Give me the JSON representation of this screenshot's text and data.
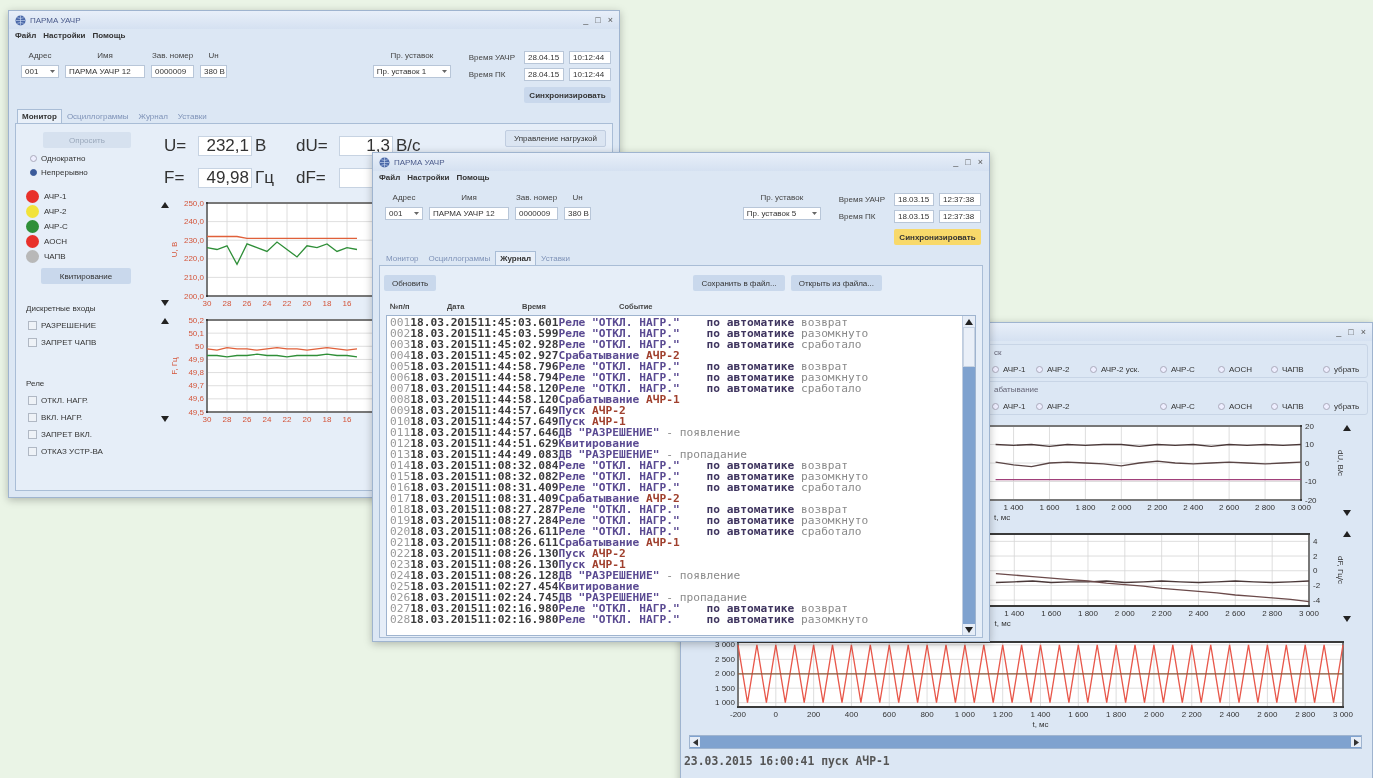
{
  "monitor_window": {
    "title": "ПАРМА УАЧР",
    "controls": [
      "_",
      "□",
      "×"
    ],
    "menu": [
      "Файл",
      "Настройки",
      "Помощь"
    ],
    "device": {
      "labels": [
        "Адрес",
        "Имя",
        "Зав. номер",
        "Uн"
      ],
      "address": "001",
      "name": "ПАРМА УАЧР 12",
      "serial": "0000009",
      "voltage": "380 В"
    },
    "settings": {
      "label": "Пр. уставок",
      "value": "Пр. уставок 1"
    },
    "clock": {
      "device_label": "Время УАЧР",
      "device_date": "28.04.15",
      "device_time": "10:12:44",
      "pc_label": "Время ПК",
      "pc_date": "28.04.15",
      "pc_time": "10:12:44"
    },
    "sync_button": {
      "label": "Синхронизировать",
      "highlighted": false
    },
    "tabs": [
      {
        "label": "Монитор",
        "selected": true
      },
      {
        "label": "Осциллограммы",
        "selected": false
      },
      {
        "label": "Журнал",
        "selected": false
      },
      {
        "label": "Уставки",
        "selected": false
      }
    ],
    "poll_button": {
      "label": "Опросить",
      "disabled": true
    },
    "poll_modes": [
      {
        "label": "Однократно",
        "selected": false
      },
      {
        "label": "Непрерывно",
        "selected": true
      }
    ],
    "indicators": [
      {
        "label": "АЧР-1",
        "color": "#e8302a"
      },
      {
        "label": "АЧР-2",
        "color": "#f2e33a"
      },
      {
        "label": "АЧР-С",
        "color": "#2f8f38"
      },
      {
        "label": "АОСН",
        "color": "#e8302a"
      },
      {
        "label": "ЧАПВ",
        "color": "#b8b8b8"
      }
    ],
    "ack_button": "Квитирование",
    "inputs": {
      "title": "Дискретные входы",
      "items": [
        {
          "label": "РАЗРЕШЕНИЕ",
          "checked": false
        },
        {
          "label": "ЗАПРЕТ ЧАПВ",
          "checked": false
        }
      ]
    },
    "relays": {
      "title": "Реле",
      "items": [
        {
          "label": "ОТКЛ. НАГР.",
          "checked": false
        },
        {
          "label": "ВКЛ. НАГР.",
          "checked": false
        },
        {
          "label": "ЗАПРЕТ ВКЛ.",
          "checked": false
        },
        {
          "label": "ОТКАЗ УСТР-ВА",
          "checked": false
        }
      ]
    },
    "readings": [
      {
        "label": "U=",
        "value": "232,1",
        "unit": "В"
      },
      {
        "label": "dU=",
        "value": "1,3",
        "unit": "В/с"
      },
      {
        "label": "F=",
        "value": "49,98",
        "unit": "Гц"
      },
      {
        "label": "dF="
      }
    ],
    "load_control": "Управление нагрузкой",
    "voltage_chart": {
      "chart_data": {
        "type": "line",
        "ylabel": "U, В",
        "grid": true,
        "x": [
          30,
          29,
          28,
          27,
          26,
          25,
          24,
          23,
          22,
          21,
          20,
          19,
          18,
          17,
          16,
          15
        ],
        "xlim": [
          30,
          13
        ],
        "ylim": [
          200,
          250
        ],
        "xticks": [
          30,
          28,
          26,
          24,
          22,
          20,
          18,
          16
        ],
        "yticks": [
          {
            "value": 200,
            "label": "200,0"
          },
          {
            "value": 210,
            "label": "210,0"
          },
          {
            "value": 220,
            "label": "220,0"
          },
          {
            "value": 230,
            "label": "230,0"
          },
          {
            "value": 240,
            "label": "240,0"
          },
          {
            "value": 250,
            "label": "250,0"
          }
        ],
        "series": [
          {
            "color": "#e0603a",
            "values": [
              232,
              232,
              232,
              232,
              231,
              231,
              231,
              231,
              231,
              231,
              231,
              231,
              231,
              231,
              231,
              231
            ]
          },
          {
            "color": "#2f8f38",
            "values": [
              226,
              225,
              227,
              217,
              228,
              226,
              224,
              229,
              225,
              221,
              227,
              226,
              228,
              224,
              226,
              225
            ]
          }
        ]
      }
    },
    "frequency_chart": {
      "chart_data": {
        "type": "line",
        "ylabel": "F, Гц",
        "grid": true,
        "x": [
          30,
          29,
          28,
          27,
          26,
          25,
          24,
          23,
          22,
          21,
          20,
          19,
          18,
          17,
          16,
          15
        ],
        "xlim": [
          30,
          13
        ],
        "ylim": [
          49.5,
          50.2
        ],
        "xticks": [
          30,
          28,
          26,
          24,
          22,
          20,
          18,
          16
        ],
        "yticks": [
          {
            "value": 49.5,
            "label": "49,5"
          },
          {
            "value": 49.6,
            "label": "49,6"
          },
          {
            "value": 49.7,
            "label": "49,7"
          },
          {
            "value": 49.8,
            "label": "49,8"
          },
          {
            "value": 49.9,
            "label": "49,9"
          },
          {
            "value": 50,
            "label": "50"
          },
          {
            "value": 50.1,
            "label": "50,1"
          },
          {
            "value": 50.2,
            "label": "50,2"
          }
        ],
        "series": [
          {
            "color": "#e0603a",
            "values": [
              49.98,
              49.97,
              49.99,
              49.98,
              49.98,
              49.97,
              49.98,
              49.99,
              49.98,
              49.98,
              49.97,
              49.98,
              49.99,
              49.98,
              49.97,
              49.98
            ]
          },
          {
            "color": "#2f8f38",
            "values": [
              49.93,
              49.93,
              49.92,
              49.93,
              49.93,
              49.94,
              49.93,
              49.93,
              49.92,
              49.93,
              49.93,
              49.93,
              49.94,
              49.93,
              49.93,
              49.92
            ]
          }
        ]
      }
    }
  },
  "journal_window": {
    "title": "ПАРМА УАЧР",
    "controls": [
      "_",
      "□",
      "×"
    ],
    "menu": [
      "Файл",
      "Настройки",
      "Помощь"
    ],
    "device": {
      "labels": [
        "Адрес",
        "Имя",
        "Зав. номер",
        "Uн"
      ],
      "address": "001",
      "name": "ПАРМА УАЧР 12",
      "serial": "0000009",
      "voltage": "380 В"
    },
    "settings": {
      "label": "Пр. уставок",
      "value": "Пр. уставок 5"
    },
    "clock": {
      "device_label": "Время УАЧР",
      "device_date": "18.03.15",
      "device_time": "12:37:38",
      "pc_label": "Время ПК",
      "pc_date": "18.03.15",
      "pc_time": "12:37:38"
    },
    "sync_button": {
      "label": "Синхронизировать",
      "highlighted": true
    },
    "tabs": [
      {
        "label": "Монитор",
        "selected": false
      },
      {
        "label": "Осциллограммы",
        "selected": false
      },
      {
        "label": "Журнал",
        "selected": true
      },
      {
        "label": "Уставки",
        "selected": false
      }
    ],
    "refresh_button": "Обновить",
    "save_button": "Сохранить в файл...",
    "open_button": "Открыть из файла...",
    "columns": [
      "№п/п",
      "Дата",
      "Время",
      "Событие"
    ],
    "rows": [
      {
        "num": "001",
        "date": "18.03.2015",
        "time": "11:45:03.601",
        "event": [
          {
            "text": "Реле \"ОТКЛ. НАГР.\"",
            "kind": "name"
          },
          {
            "text": "по автоматике",
            "kind": "mode"
          },
          {
            "text": "возврат",
            "kind": "state"
          }
        ]
      },
      {
        "num": "002",
        "date": "18.03.2015",
        "time": "11:45:03.599",
        "event": [
          {
            "text": "Реле \"ОТКЛ. НАГР.\"",
            "kind": "name"
          },
          {
            "text": "по автоматике",
            "kind": "mode"
          },
          {
            "text": "разомкнуто",
            "kind": "state"
          }
        ]
      },
      {
        "num": "003",
        "date": "18.03.2015",
        "time": "11:45:02.928",
        "event": [
          {
            "text": "Реле \"ОТКЛ. НАГР.\"",
            "kind": "name"
          },
          {
            "text": "по автоматике",
            "kind": "mode"
          },
          {
            "text": "сработало",
            "kind": "state"
          }
        ]
      },
      {
        "num": "004",
        "date": "18.03.2015",
        "time": "11:45:02.927",
        "event": [
          {
            "text": "Срабатывание",
            "kind": "name"
          },
          {
            "text": "АЧР-2",
            "kind": "signal"
          }
        ]
      },
      {
        "num": "005",
        "date": "18.03.2015",
        "time": "11:44:58.796",
        "event": [
          {
            "text": "Реле \"ОТКЛ. НАГР.\"",
            "kind": "name"
          },
          {
            "text": "по автоматике",
            "kind": "mode"
          },
          {
            "text": "возврат",
            "kind": "state"
          }
        ]
      },
      {
        "num": "006",
        "date": "18.03.2015",
        "time": "11:44:58.794",
        "event": [
          {
            "text": "Реле \"ОТКЛ. НАГР.\"",
            "kind": "name"
          },
          {
            "text": "по автоматике",
            "kind": "mode"
          },
          {
            "text": "разомкнуто",
            "kind": "state"
          }
        ]
      },
      {
        "num": "007",
        "date": "18.03.2015",
        "time": "11:44:58.120",
        "event": [
          {
            "text": "Реле \"ОТКЛ. НАГР.\"",
            "kind": "name"
          },
          {
            "text": "по автоматике",
            "kind": "mode"
          },
          {
            "text": "сработало",
            "kind": "state"
          }
        ]
      },
      {
        "num": "008",
        "date": "18.03.2015",
        "time": "11:44:58.120",
        "event": [
          {
            "text": "Срабатывание",
            "kind": "name"
          },
          {
            "text": "АЧР-1",
            "kind": "signal"
          }
        ]
      },
      {
        "num": "009",
        "date": "18.03.2015",
        "time": "11:44:57.649",
        "event": [
          {
            "text": "Пуск",
            "kind": "name"
          },
          {
            "text": "АЧР-2",
            "kind": "signal"
          }
        ]
      },
      {
        "num": "010",
        "date": "18.03.2015",
        "time": "11:44:57.649",
        "event": [
          {
            "text": "Пуск",
            "kind": "name"
          },
          {
            "text": "АЧР-1",
            "kind": "signal"
          }
        ]
      },
      {
        "num": "011",
        "date": "18.03.2015",
        "time": "11:44:57.646",
        "event": [
          {
            "text": "ДВ \"РАЗРЕШЕНИЕ\"",
            "kind": "name"
          },
          {
            "text": "- появление",
            "kind": "state"
          }
        ]
      },
      {
        "num": "012",
        "date": "18.03.2015",
        "time": "11:44:51.629",
        "event": [
          {
            "text": "Квитирование",
            "kind": "name"
          }
        ]
      },
      {
        "num": "013",
        "date": "18.03.2015",
        "time": "11:44:49.083",
        "event": [
          {
            "text": "ДВ \"РАЗРЕШЕНИЕ\"",
            "kind": "name"
          },
          {
            "text": "- пропадание",
            "kind": "state"
          }
        ]
      },
      {
        "num": "014",
        "date": "18.03.2015",
        "time": "11:08:32.084",
        "event": [
          {
            "text": "Реле \"ОТКЛ. НАГР.\"",
            "kind": "name"
          },
          {
            "text": "по автоматике",
            "kind": "mode"
          },
          {
            "text": "возврат",
            "kind": "state"
          }
        ]
      },
      {
        "num": "015",
        "date": "18.03.2015",
        "time": "11:08:32.082",
        "event": [
          {
            "text": "Реле \"ОТКЛ. НАГР.\"",
            "kind": "name"
          },
          {
            "text": "по автоматике",
            "kind": "mode"
          },
          {
            "text": "разомкнуто",
            "kind": "state"
          }
        ]
      },
      {
        "num": "016",
        "date": "18.03.2015",
        "time": "11:08:31.409",
        "event": [
          {
            "text": "Реле \"ОТКЛ. НАГР.\"",
            "kind": "name"
          },
          {
            "text": "по автоматике",
            "kind": "mode"
          },
          {
            "text": "сработало",
            "kind": "state"
          }
        ]
      },
      {
        "num": "017",
        "date": "18.03.2015",
        "time": "11:08:31.409",
        "event": [
          {
            "text": "Срабатывание",
            "kind": "name"
          },
          {
            "text": "АЧР-2",
            "kind": "signal"
          }
        ]
      },
      {
        "num": "018",
        "date": "18.03.2015",
        "time": "11:08:27.287",
        "event": [
          {
            "text": "Реле \"ОТКЛ. НАГР.\"",
            "kind": "name"
          },
          {
            "text": "по автоматике",
            "kind": "mode"
          },
          {
            "text": "возврат",
            "kind": "state"
          }
        ]
      },
      {
        "num": "019",
        "date": "18.03.2015",
        "time": "11:08:27.284",
        "event": [
          {
            "text": "Реле \"ОТКЛ. НАГР.\"",
            "kind": "name"
          },
          {
            "text": "по автоматике",
            "kind": "mode"
          },
          {
            "text": "разомкнуто",
            "kind": "state"
          }
        ]
      },
      {
        "num": "020",
        "date": "18.03.2015",
        "time": "11:08:26.611",
        "event": [
          {
            "text": "Реле \"ОТКЛ. НАГР.\"",
            "kind": "name"
          },
          {
            "text": "по автоматике",
            "kind": "mode"
          },
          {
            "text": "сработало",
            "kind": "state"
          }
        ]
      },
      {
        "num": "021",
        "date": "18.03.2015",
        "time": "11:08:26.611",
        "event": [
          {
            "text": "Срабатывание",
            "kind": "name"
          },
          {
            "text": "АЧР-1",
            "kind": "signal"
          }
        ]
      },
      {
        "num": "022",
        "date": "18.03.2015",
        "time": "11:08:26.130",
        "event": [
          {
            "text": "Пуск",
            "kind": "name"
          },
          {
            "text": "АЧР-2",
            "kind": "signal"
          }
        ]
      },
      {
        "num": "023",
        "date": "18.03.2015",
        "time": "11:08:26.130",
        "event": [
          {
            "text": "Пуск",
            "kind": "name"
          },
          {
            "text": "АЧР-1",
            "kind": "signal"
          }
        ]
      },
      {
        "num": "024",
        "date": "18.03.2015",
        "time": "11:08:26.128",
        "event": [
          {
            "text": "ДВ \"РАЗРЕШЕНИЕ\"",
            "kind": "name"
          },
          {
            "text": "- появление",
            "kind": "state"
          }
        ]
      },
      {
        "num": "025",
        "date": "18.03.2015",
        "time": "11:02:27.454",
        "event": [
          {
            "text": "Квитирование",
            "kind": "name"
          }
        ]
      },
      {
        "num": "026",
        "date": "18.03.2015",
        "time": "11:02:24.745",
        "event": [
          {
            "text": "ДВ \"РАЗРЕШЕНИЕ\"",
            "kind": "name"
          },
          {
            "text": "- пропадание",
            "kind": "state"
          }
        ]
      },
      {
        "num": "027",
        "date": "18.03.2015",
        "time": "11:02:16.980",
        "event": [
          {
            "text": "Реле \"ОТКЛ. НАГР.\"",
            "kind": "name"
          },
          {
            "text": "по автоматике",
            "kind": "mode"
          },
          {
            "text": "возврат",
            "kind": "state"
          }
        ]
      },
      {
        "num": "028",
        "date": "18.03.2015",
        "time": "11:02:16.980",
        "event": [
          {
            "text": "Реле \"ОТКЛ. НАГР.\"",
            "kind": "name"
          },
          {
            "text": "по автоматике",
            "kind": "mode"
          },
          {
            "text": "разомкнуто",
            "kind": "state"
          }
        ]
      }
    ]
  },
  "oscillogram_window": {
    "controls": [
      "_",
      "□",
      "×"
    ],
    "start_group": {
      "label": "ск",
      "left_options": [
        {
          "label": "АЧР-1",
          "selected": false
        },
        {
          "label": "АЧР-2",
          "selected": false
        },
        {
          "label": "АЧР-2 уск.",
          "selected": false
        }
      ],
      "right_options": [
        {
          "label": "АЧР-С",
          "selected": false
        },
        {
          "label": "АОСН",
          "selected": false
        },
        {
          "label": "ЧАПВ",
          "selected": false
        },
        {
          "label": "убрать",
          "selected": false
        }
      ]
    },
    "trip_group": {
      "label": "абатывание",
      "left_options": [
        {
          "label": "АЧР-1",
          "selected": false
        },
        {
          "label": "АЧР-2",
          "selected": false
        }
      ],
      "right_options": [
        {
          "label": "АЧР-С",
          "selected": false
        },
        {
          "label": "АОСН",
          "selected": false
        },
        {
          "label": "ЧАПВ",
          "selected": false
        },
        {
          "label": "убрать",
          "selected": false
        }
      ]
    },
    "du_chart": {
      "chart_data": {
        "type": "line",
        "xlabel": "t, мс",
        "ylabel": "dU, В/с",
        "grid": true,
        "x": [
          1300,
          1400,
          1500,
          1600,
          1700,
          1800,
          1900,
          2000,
          2100,
          2200,
          2300,
          2400,
          2500,
          2600,
          2700,
          2800,
          2900,
          3000
        ],
        "xlim": [
          1230,
          3000
        ],
        "ylim": [
          -20,
          20
        ],
        "xticks": [
          {
            "value": 1400,
            "label": "1 400"
          },
          {
            "value": 1600,
            "label": "1 600"
          },
          {
            "value": 1800,
            "label": "1 800"
          },
          {
            "value": 2000,
            "label": "2 000"
          },
          {
            "value": 2200,
            "label": "2 200"
          },
          {
            "value": 2400,
            "label": "2 400"
          },
          {
            "value": 2600,
            "label": "2 600"
          },
          {
            "value": 2800,
            "label": "2 800"
          },
          {
            "value": 3000,
            "label": "3 000"
          }
        ],
        "yticks": [
          -20,
          -10,
          0,
          10,
          20
        ],
        "series": [
          {
            "color": "#4a3838",
            "values": [
              10,
              9.5,
              10,
              9,
              10,
              9.5,
              10,
              10,
              9,
              10,
              9.5,
              10,
              9,
              10,
              9.5,
              10,
              9.5,
              10
            ]
          },
          {
            "color": "#5a4545",
            "values": [
              0.5,
              -1,
              -2,
              0,
              0.5,
              0,
              -0.5,
              -1.5,
              0,
              1,
              0,
              -0.5,
              0,
              0.5,
              0,
              -0.5,
              0,
              0.5
            ]
          },
          {
            "color": "#a0407a",
            "values": [
              -9,
              -9,
              -9,
              -9,
              -9,
              -9,
              -9,
              -9,
              -9,
              -9,
              -9,
              -9,
              -9,
              -9,
              -9,
              -9,
              -9,
              -9
            ]
          }
        ]
      }
    },
    "df_chart": {
      "chart_data": {
        "type": "line",
        "xlabel": "t, мс",
        "ylabel": "dF, Гц/с",
        "grid": true,
        "x": [
          1300,
          1400,
          1500,
          1600,
          1700,
          1800,
          1900,
          2000,
          2100,
          2200,
          2300,
          2400,
          2500,
          2600,
          2700,
          2800,
          2900,
          3000
        ],
        "xlim": [
          1230,
          3000
        ],
        "ylim": [
          -4.8,
          5
        ],
        "xticks": [
          {
            "value": 1400,
            "label": "1 400"
          },
          {
            "value": 1600,
            "label": "1 600"
          },
          {
            "value": 1800,
            "label": "1 800"
          },
          {
            "value": 2000,
            "label": "2 000"
          },
          {
            "value": 2200,
            "label": "2 200"
          },
          {
            "value": 2400,
            "label": "2 400"
          },
          {
            "value": 2600,
            "label": "2 600"
          },
          {
            "value": 2800,
            "label": "2 800"
          },
          {
            "value": 3000,
            "label": "3 000"
          }
        ],
        "yticks": [
          -4,
          -2,
          0,
          2,
          4
        ],
        "series": [
          {
            "color": "#4a3838",
            "values": [
              -1.6,
              -1.5,
              -1.4,
              -1.6,
              -1.5,
              -1.5,
              -1.4,
              -1.6,
              -1.5,
              -1.4,
              -1.5,
              -1.6,
              -1.5,
              -1.4,
              -1.5,
              -1.6,
              -1.5,
              -1.4
            ]
          },
          {
            "color": "#6b4a4a",
            "values": [
              -0.4,
              -0.6,
              -0.8,
              -1.0,
              -1.2,
              -1.4,
              -1.7,
              -1.9,
              -2.1,
              -2.4,
              -2.6,
              -2.8,
              -3.0,
              -3.3,
              -3.5,
              -3.7,
              -3.9,
              -4.2
            ]
          }
        ]
      }
    },
    "wave_chart": {
      "chart_data": {
        "type": "line",
        "xlabel": "t, мс",
        "grid": true,
        "x": [
          -200,
          -150,
          -100,
          -50,
          0,
          50,
          100,
          150,
          200,
          250,
          300,
          350,
          400,
          450,
          500,
          550,
          600,
          650,
          700,
          750,
          800,
          850,
          900,
          950,
          1000,
          1050,
          1100,
          1150,
          1200,
          1250,
          1300,
          1350,
          1400,
          1450,
          1500,
          1550,
          1600,
          1650,
          1700,
          1750,
          1800,
          1850,
          1900,
          1950,
          2000,
          2050,
          2100,
          2150,
          2200,
          2250,
          2300,
          2350,
          2400,
          2450,
          2500,
          2550,
          2600,
          2650,
          2700,
          2750,
          2800,
          2850,
          2900,
          2950,
          3000
        ],
        "xlim": [
          -200,
          3000
        ],
        "ylim": [
          850,
          3100
        ],
        "xticks": [
          -200,
          0,
          200,
          400,
          600,
          800,
          {
            "value": 1000,
            "label": "1 000"
          },
          {
            "value": 1200,
            "label": "1 200"
          },
          {
            "value": 1400,
            "label": "1 400"
          },
          {
            "value": 1600,
            "label": "1 600"
          },
          {
            "value": 1800,
            "label": "1 800"
          },
          {
            "value": 2000,
            "label": "2 000"
          },
          {
            "value": 2200,
            "label": "2 200"
          },
          {
            "value": 2400,
            "label": "2 400"
          },
          {
            "value": 2600,
            "label": "2 600"
          },
          {
            "value": 2800,
            "label": "2 800"
          },
          {
            "value": 3000,
            "label": "3 000"
          }
        ],
        "yticks": [
          {
            "value": 1000,
            "label": "1 000"
          },
          {
            "value": 1500,
            "label": "1 500"
          },
          {
            "value": 2000,
            "label": "2 000"
          },
          {
            "value": 2500,
            "label": "2 500"
          },
          {
            "value": 3000,
            "label": "3 000"
          }
        ],
        "series": [
          {
            "color": "#e8574a",
            "values": [
              3000,
              1000,
              3000,
              1000,
              3000,
              1000,
              3000,
              1000,
              3000,
              1000,
              3000,
              1000,
              3000,
              1000,
              3000,
              1000,
              3000,
              1000,
              3000,
              1000,
              3000,
              1000,
              3000,
              1000,
              3000,
              1000,
              3000,
              1000,
              3000,
              1000,
              3000,
              1000,
              3000,
              1000,
              3000,
              1000,
              3000,
              1000,
              3000,
              1000,
              3000,
              1000,
              3000,
              1000,
              3000,
              1000,
              3000,
              1000,
              3000,
              1000,
              3000,
              1000,
              3000,
              1000,
              3000,
              1000,
              3000,
              1000,
              3000,
              1000,
              3000,
              1000,
              3000,
              1000,
              3000
            ]
          },
          {
            "color": "#8a5a3a",
            "values": [
              2000,
              2000,
              2000,
              2000,
              2000,
              2000,
              2000,
              2000,
              2000,
              2000,
              2000,
              2000,
              2000,
              2000,
              2000,
              2000,
              2000,
              2000,
              2000,
              2000,
              2000,
              2000,
              2000,
              2000,
              2000,
              2000,
              2000,
              2000,
              2000,
              2000,
              2000,
              2000,
              2000,
              2000,
              2000,
              2000,
              2000,
              2000,
              2000,
              2000,
              2000,
              2000,
              2000,
              2000,
              2000,
              2000,
              2000,
              2000,
              2000,
              2000,
              2000,
              2000,
              2000,
              2000,
              2000,
              2000,
              2000,
              2000,
              2000,
              2000,
              2000,
              2000,
              2000,
              2000,
              2000
            ]
          }
        ]
      }
    },
    "status": "23.03.2015 16:00:41 пуск АЧР-1"
  }
}
